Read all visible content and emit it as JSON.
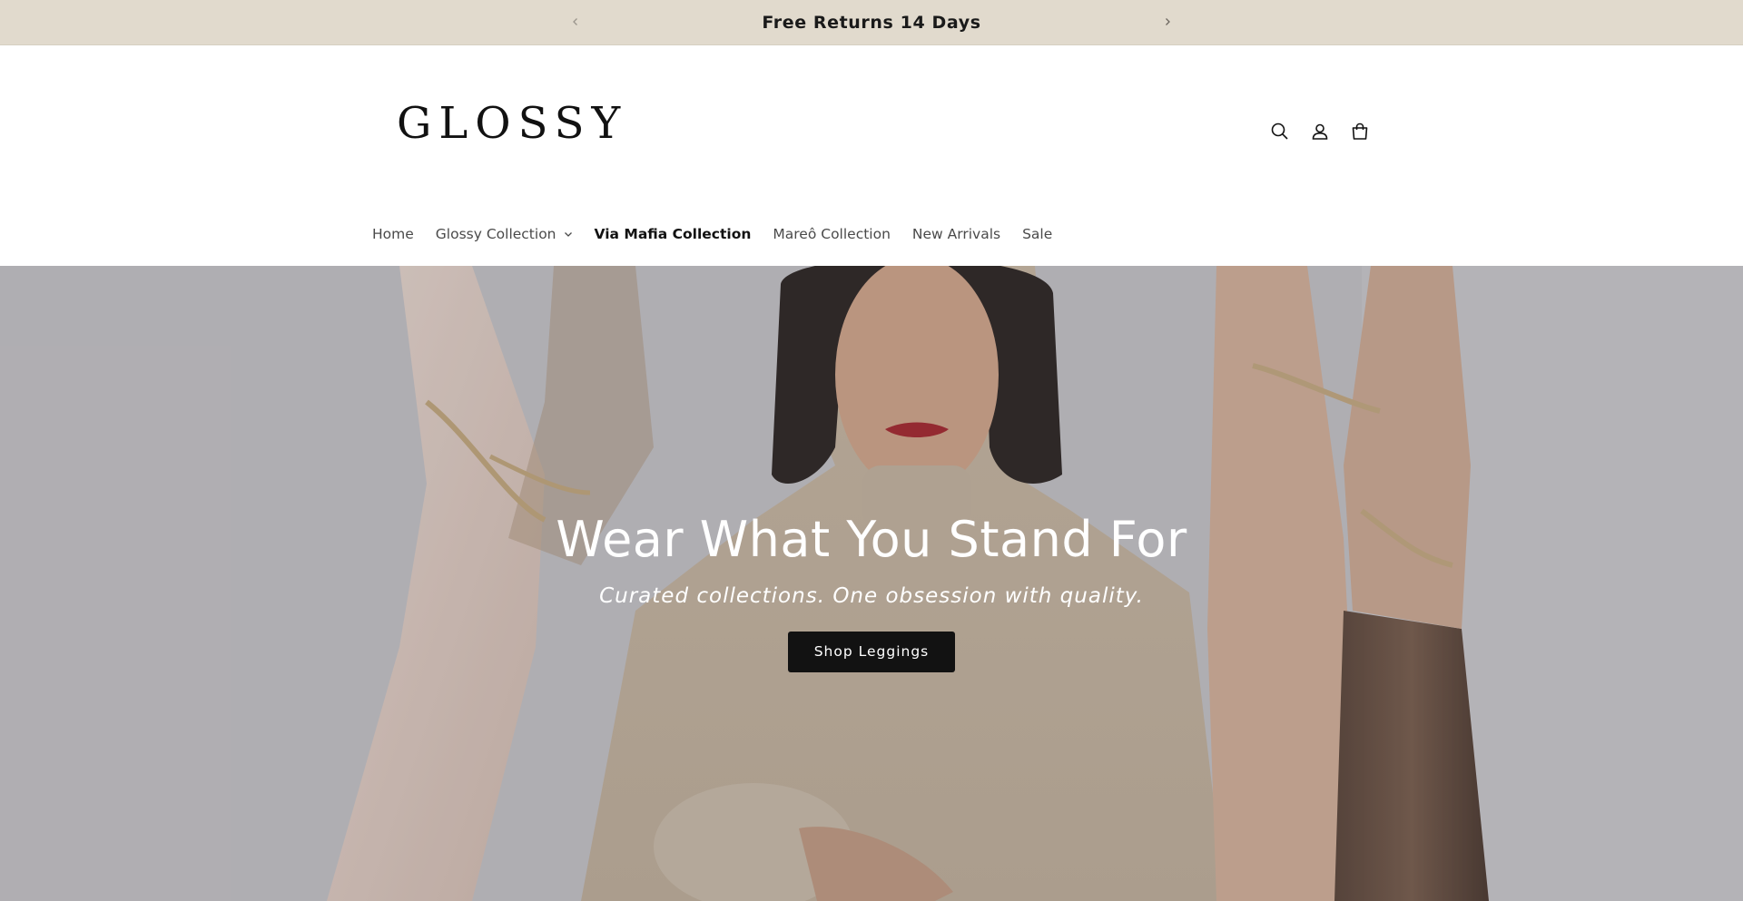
{
  "announcement": {
    "text": "Free Returns 14 Days",
    "prev_icon": "chevron-left-icon",
    "next_icon": "chevron-right-icon"
  },
  "header": {
    "logo": "GLOSSY",
    "icons": [
      "search-icon",
      "account-icon",
      "cart-icon"
    ]
  },
  "nav": {
    "items": [
      {
        "label": "Home"
      },
      {
        "label": "Glossy Collection"
      },
      {
        "label": "Via Mafia Collection"
      },
      {
        "label": "Mareô Collection"
      },
      {
        "label": "New Arrivals"
      },
      {
        "label": "Sale"
      }
    ]
  },
  "hero": {
    "title": "Wear What You Stand For",
    "subtitle": "Curated collections. One obsession with quality.",
    "button": "Shop Leggings"
  },
  "colors": {
    "announcement_bg": "#e1dacd",
    "button_bg": "#121212",
    "text": "#121212"
  }
}
